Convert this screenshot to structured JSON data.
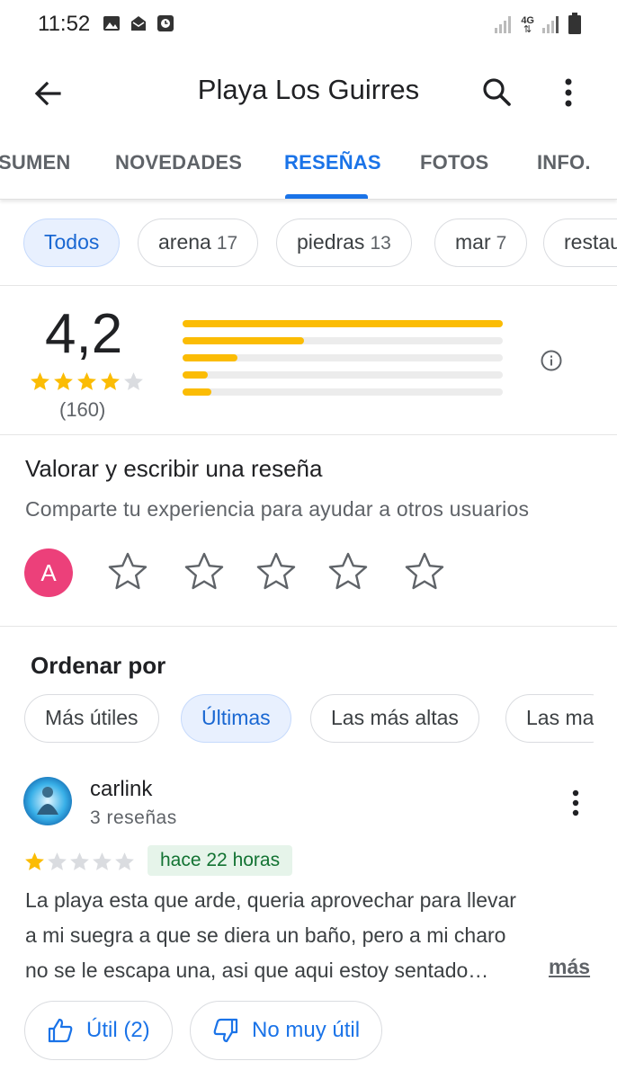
{
  "status_bar": {
    "time": "11:52",
    "network_label": "4G"
  },
  "app_bar": {
    "title": "Playa Los Guirres"
  },
  "tabs": [
    {
      "label": "SUMEN"
    },
    {
      "label": "NOVEDADES"
    },
    {
      "label": "RESEÑAS"
    },
    {
      "label": "FOTOS"
    },
    {
      "label": "INFO."
    }
  ],
  "active_tab": "RESEÑAS",
  "topics": [
    {
      "label": "Todos",
      "count": ""
    },
    {
      "label": "arena",
      "count": "17"
    },
    {
      "label": "piedras",
      "count": "13"
    },
    {
      "label": "mar",
      "count": "7"
    },
    {
      "label": "restau",
      "count": ""
    }
  ],
  "rating": {
    "score": "4,2",
    "count_label": "(160)",
    "stars_filled": 4,
    "distribution_fraction": {
      "5": 1.0,
      "4": 0.38,
      "3": 0.17,
      "2": 0.08,
      "1": 0.09
    },
    "bar_color": "#fbbc04"
  },
  "write_review": {
    "title": "Valorar y escribir una reseña",
    "subtitle": "Comparte tu experiencia para ayudar a otros usuarios",
    "avatar_letter": "A",
    "avatar_color": "#ec407a"
  },
  "sort": {
    "title": "Ordenar por",
    "options": [
      "Más útiles",
      "Últimas",
      "Las más altas",
      "Las ma"
    ],
    "selected": "Últimas"
  },
  "review": {
    "author": "carlink",
    "author_reviews": "3 reseñas",
    "stars_filled": 1,
    "time": "hace 22 horas",
    "text_lines": [
      "La playa esta que arde, queria aprovechar para llevar",
      "a mi suegra a que se diera un baño, pero a mi charo",
      "no se le escapa una, asi que aqui estoy sentado…"
    ],
    "more_label": "más",
    "helpful_label": "Útil (2)",
    "not_helpful_label": "No muy útil"
  },
  "colors": {
    "accent": "#1a73e8",
    "star": "#fbbc04",
    "star_empty": "#dadce0"
  }
}
